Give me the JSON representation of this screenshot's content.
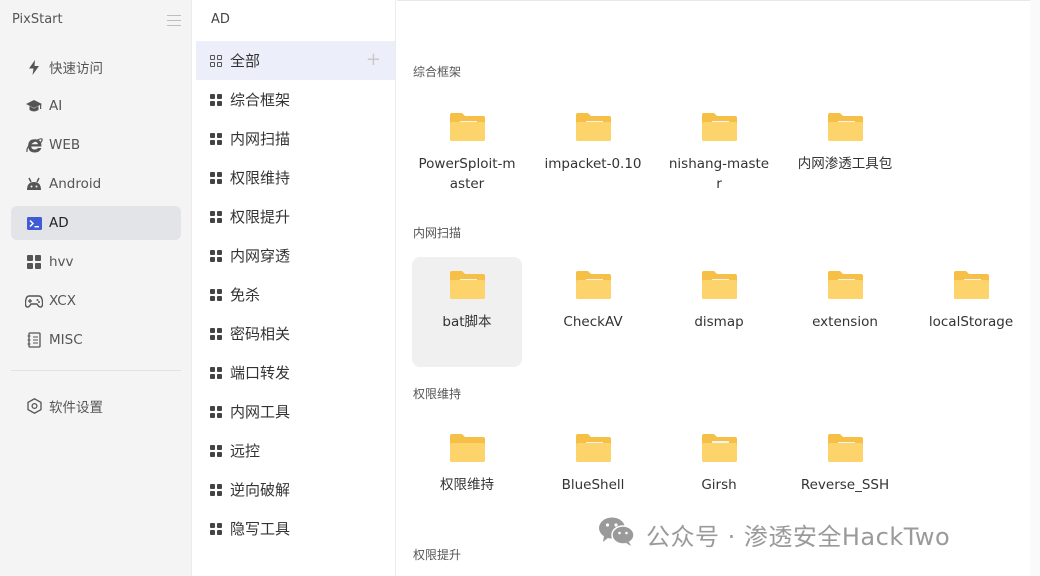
{
  "app": {
    "title": "PixStart"
  },
  "sidebar": {
    "items": [
      {
        "label": "快速访问",
        "icon": "lightning-icon"
      },
      {
        "label": "AI",
        "icon": "graduation-cap-icon"
      },
      {
        "label": "WEB",
        "icon": "ie-browser-icon"
      },
      {
        "label": "Android",
        "icon": "android-icon"
      },
      {
        "label": "AD",
        "icon": "terminal-icon",
        "active": true
      },
      {
        "label": "hvv",
        "icon": "grid-icon"
      },
      {
        "label": "XCX",
        "icon": "gamepad-icon"
      },
      {
        "label": "MISC",
        "icon": "notebook-icon"
      }
    ],
    "settings": {
      "label": "软件设置",
      "icon": "settings-hex-icon"
    }
  },
  "breadcrumb": "AD",
  "categories": {
    "all_label": "全部",
    "add_symbol": "+",
    "items": [
      "综合框架",
      "内网扫描",
      "权限维持",
      "权限提升",
      "内网穿透",
      "免杀",
      "密码相关",
      "端口转发",
      "内网工具",
      "远控",
      "逆向破解",
      "隐写工具"
    ]
  },
  "sections": [
    {
      "title": "综合框架",
      "items": [
        "PowerSploit-master",
        "impacket-0.10",
        "nishang-master",
        "内网渗透工具包"
      ]
    },
    {
      "title": "内网扫描",
      "items": [
        "bat脚本",
        "CheckAV",
        "dismap",
        "extension",
        "localStorage"
      ]
    },
    {
      "title": "权限维持",
      "items": [
        "权限维持",
        "BlueShell",
        "Girsh",
        "Reverse_SSH"
      ]
    },
    {
      "title": "权限提升",
      "items": []
    }
  ],
  "watermark": {
    "text": "公众号 · 渗透安全HackTwo"
  },
  "colors": {
    "folder_body": "#fcd46b",
    "folder_tab": "#f6bf45",
    "active_nav": "#e3e4e7",
    "active_category": "#eceef9"
  }
}
